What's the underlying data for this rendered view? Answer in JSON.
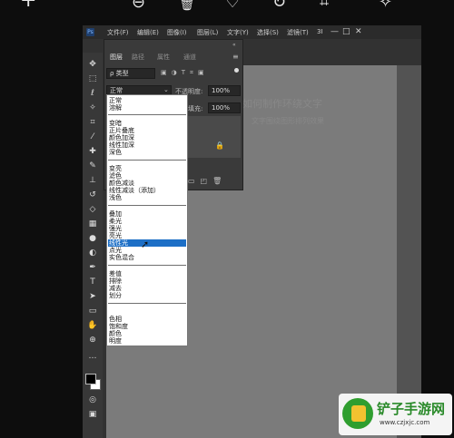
{
  "viewer_toolbar": {
    "plus": "+",
    "zoom": "⊖",
    "trash": "🗑",
    "heart": "♡",
    "rotate": "↻",
    "crop": "⌗",
    "magic": "✧"
  },
  "menubar": {
    "logo": "Ps",
    "items": [
      "文件(F)",
      "编辑(E)",
      "图像(I)",
      "图层(L)",
      "文字(Y)",
      "选择(S)",
      "滤镜(T)",
      "3I"
    ],
    "minimize": "—",
    "restore": "□",
    "close": "✕"
  },
  "layers_panel": {
    "tabs": [
      "图层",
      "路径",
      "属性",
      "通道"
    ],
    "filter_kind": "ρ 类型",
    "blend_mode": "正常",
    "opacity_label": "不透明度:",
    "opacity_value": "100%",
    "fill_label": "填充:",
    "fill_value": "100%",
    "lock_icon": "🔒"
  },
  "blend_mode_list": {
    "groups": [
      [
        "正常",
        "溶解"
      ],
      [
        "变暗",
        "正片叠底",
        "颜色加深",
        "线性加深",
        "深色"
      ],
      [
        "变亮",
        "滤色",
        "颜色减淡",
        "线性减淡（添加）",
        "浅色"
      ],
      [
        "叠加",
        "柔光",
        "强光",
        "亮光",
        "线性光",
        "点光",
        "实色混合"
      ],
      [
        "差值",
        "排除",
        "减去",
        "划分"
      ],
      [
        "色相",
        "饱和度",
        "颜色",
        "明度"
      ]
    ],
    "selected": "线性光"
  },
  "canvas": {
    "text_line_1": "如何制作环绕文字",
    "text_line_2": "文字围绕图形排列效果"
  },
  "watermark": {
    "title": "铲子手游网",
    "url": "www.czjxjc.com"
  },
  "colors": {
    "selection": "#1d6fc6",
    "canvas": "#7b7b7b",
    "app_bg": "#323232"
  }
}
